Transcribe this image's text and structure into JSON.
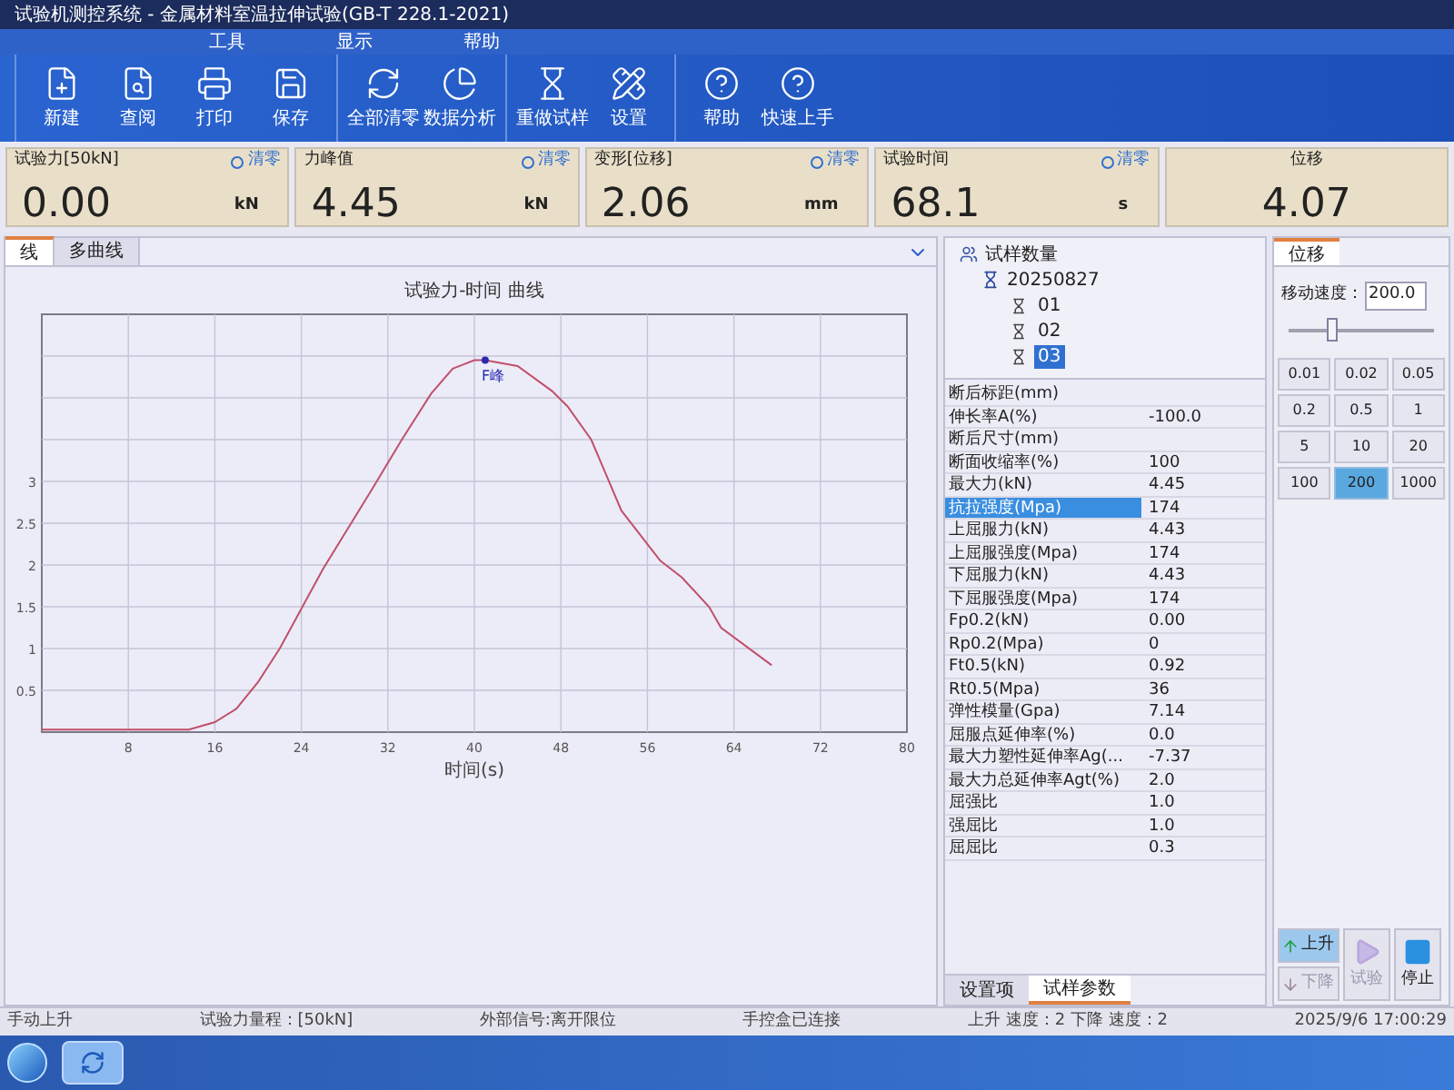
{
  "window": {
    "title": "试验机测控系统 - 金属材料室温拉伸试验(GB-T 228.1-2021)"
  },
  "menu": [
    "工具",
    "显示",
    "帮助"
  ],
  "toolbar": {
    "groups": [
      [
        "新建",
        "查阅",
        "打印",
        "保存"
      ],
      [
        "全部清零",
        "数据分析"
      ],
      [
        "重做试样",
        "设置"
      ],
      [
        "帮助",
        "快速上手"
      ]
    ]
  },
  "readouts": [
    {
      "label": "试验力[50kN]",
      "value": "0.00",
      "unit": "kN",
      "zero": {
        "label": "清零",
        "checked": false
      }
    },
    {
      "label": "力峰值",
      "value": "4.45",
      "unit": "kN",
      "zero": {
        "label": "清零",
        "checked": false
      }
    },
    {
      "label": "变形[位移]",
      "value": "2.06",
      "unit": "mm",
      "zero": {
        "label": "清零",
        "checked": false
      }
    },
    {
      "label": "试验时间",
      "value": "68.1",
      "unit": "s",
      "zero": {
        "label": "清零",
        "checked": false
      }
    },
    {
      "label": "位移",
      "value": "4.07"
    }
  ],
  "chart_panel": {
    "tabs": [
      {
        "label": "线",
        "selected": true
      },
      {
        "label": "多曲线",
        "selected": false
      }
    ],
    "chart_data": {
      "type": "line",
      "grid": true,
      "title": "试验力-时间 曲线",
      "xlabel": "时间(s)",
      "xlim": [
        0,
        80
      ],
      "ylim": [
        0,
        5
      ],
      "xticks": [
        8,
        16,
        24,
        32,
        40,
        48,
        56,
        64,
        72,
        80
      ],
      "yticks": [
        0.5,
        1,
        1.5,
        2,
        2.5,
        3
      ],
      "x": [
        0,
        13.6,
        16,
        18,
        20,
        22,
        26,
        30.5,
        33.3,
        36,
        38,
        40,
        41,
        44,
        47.2,
        48.6,
        50.8,
        53.6,
        57.2,
        59.2,
        61.7,
        62.8,
        67.5
      ],
      "series": [
        {
          "color": "#c0506a",
          "values": [
            0.03,
            0.03,
            0.12,
            0.28,
            0.6,
            1.0,
            1.95,
            2.9,
            3.5,
            4.05,
            4.35,
            4.45,
            4.45,
            4.38,
            4.08,
            3.9,
            3.5,
            2.65,
            2.05,
            1.85,
            1.5,
            1.25,
            0.8
          ]
        }
      ],
      "annotations": [
        {
          "x": 41,
          "y": 4.45,
          "text": "F峰"
        }
      ]
    }
  },
  "specimens": {
    "label": "试样数量",
    "children": [
      {
        "label": "20250827",
        "children": [
          {
            "label": "01",
            "selected": false
          },
          {
            "label": "02",
            "selected": false
          },
          {
            "label": "03",
            "selected": true
          }
        ]
      }
    ]
  },
  "results": [
    {
      "name": "断后标距(mm)",
      "selected": false
    },
    {
      "name": "伸长率A(%)",
      "value": "-100.0",
      "selected": false
    },
    {
      "name": "断后尺寸(mm)",
      "selected": false
    },
    {
      "name": "断面收缩率(%)",
      "value": "100",
      "selected": false
    },
    {
      "name": "最大力(kN)",
      "value": "4.45",
      "selected": false
    },
    {
      "name": "抗拉强度(Mpa)",
      "value": "174",
      "selected": true
    },
    {
      "name": "上屈服力(kN)",
      "value": "4.43",
      "selected": false
    },
    {
      "name": "上屈服强度(Mpa)",
      "value": "174",
      "selected": false
    },
    {
      "name": "下屈服力(kN)",
      "value": "4.43",
      "selected": false
    },
    {
      "name": "下屈服强度(Mpa)",
      "value": "174",
      "selected": false
    },
    {
      "name": "Fp0.2(kN)",
      "value": "0.00",
      "selected": false
    },
    {
      "name": "Rp0.2(Mpa)",
      "value": "0",
      "selected": false
    },
    {
      "name": "Ft0.5(kN)",
      "value": "0.92",
      "selected": false
    },
    {
      "name": "Rt0.5(Mpa)",
      "value": "36",
      "selected": false
    },
    {
      "name": "弹性模量(Gpa)",
      "value": "7.14",
      "selected": false
    },
    {
      "name": "屈服点延伸率(%)",
      "value": "0.0",
      "selected": false
    },
    {
      "name": "最大力塑性延伸率Ag(...",
      "value": "-7.37",
      "selected": false
    },
    {
      "name": "最大力总延伸率Agt(%)",
      "value": "2.0",
      "selected": false
    },
    {
      "name": "屈强比",
      "value": "1.0",
      "selected": false
    },
    {
      "name": "强屈比",
      "value": "1.0",
      "selected": false
    },
    {
      "name": "屈屈比",
      "value": "0.3",
      "selected": false
    }
  ],
  "result_tabs": [
    {
      "label": "设置项",
      "selected": false
    },
    {
      "label": "试样参数",
      "selected": true
    }
  ],
  "control": {
    "tab": "位移",
    "speed_label": "移动速度：",
    "speed_value": "200.0",
    "slider": {
      "level": 0.3
    },
    "speeds": [
      {
        "label": "0.01",
        "selected": false
      },
      {
        "label": "0.02",
        "selected": false
      },
      {
        "label": "0.05",
        "selected": false
      },
      {
        "label": "0.2",
        "selected": false
      },
      {
        "label": "0.5",
        "selected": false
      },
      {
        "label": "1",
        "selected": false
      },
      {
        "label": "5",
        "selected": false
      },
      {
        "label": "10",
        "selected": false
      },
      {
        "label": "20",
        "selected": false
      },
      {
        "label": "100",
        "selected": false
      },
      {
        "label": "200",
        "selected": true
      },
      {
        "label": "1000",
        "selected": false
      }
    ],
    "actions": [
      {
        "kind": "up",
        "label": "上升",
        "disabled": false,
        "active": true
      },
      {
        "kind": "down",
        "label": "下降",
        "disabled": true,
        "active": false
      },
      {
        "kind": "test",
        "label": "试验",
        "disabled": true,
        "active": false
      },
      {
        "kind": "stop",
        "label": "停止",
        "disabled": false,
        "active": false
      }
    ]
  },
  "status_bar": [
    "手动上升",
    "试验力量程：[50kN]",
    "外部信号:离开限位",
    "手控盒已连接",
    "上升 速度：2 下降 速度：2",
    "2025/9/6 17:00:29"
  ]
}
